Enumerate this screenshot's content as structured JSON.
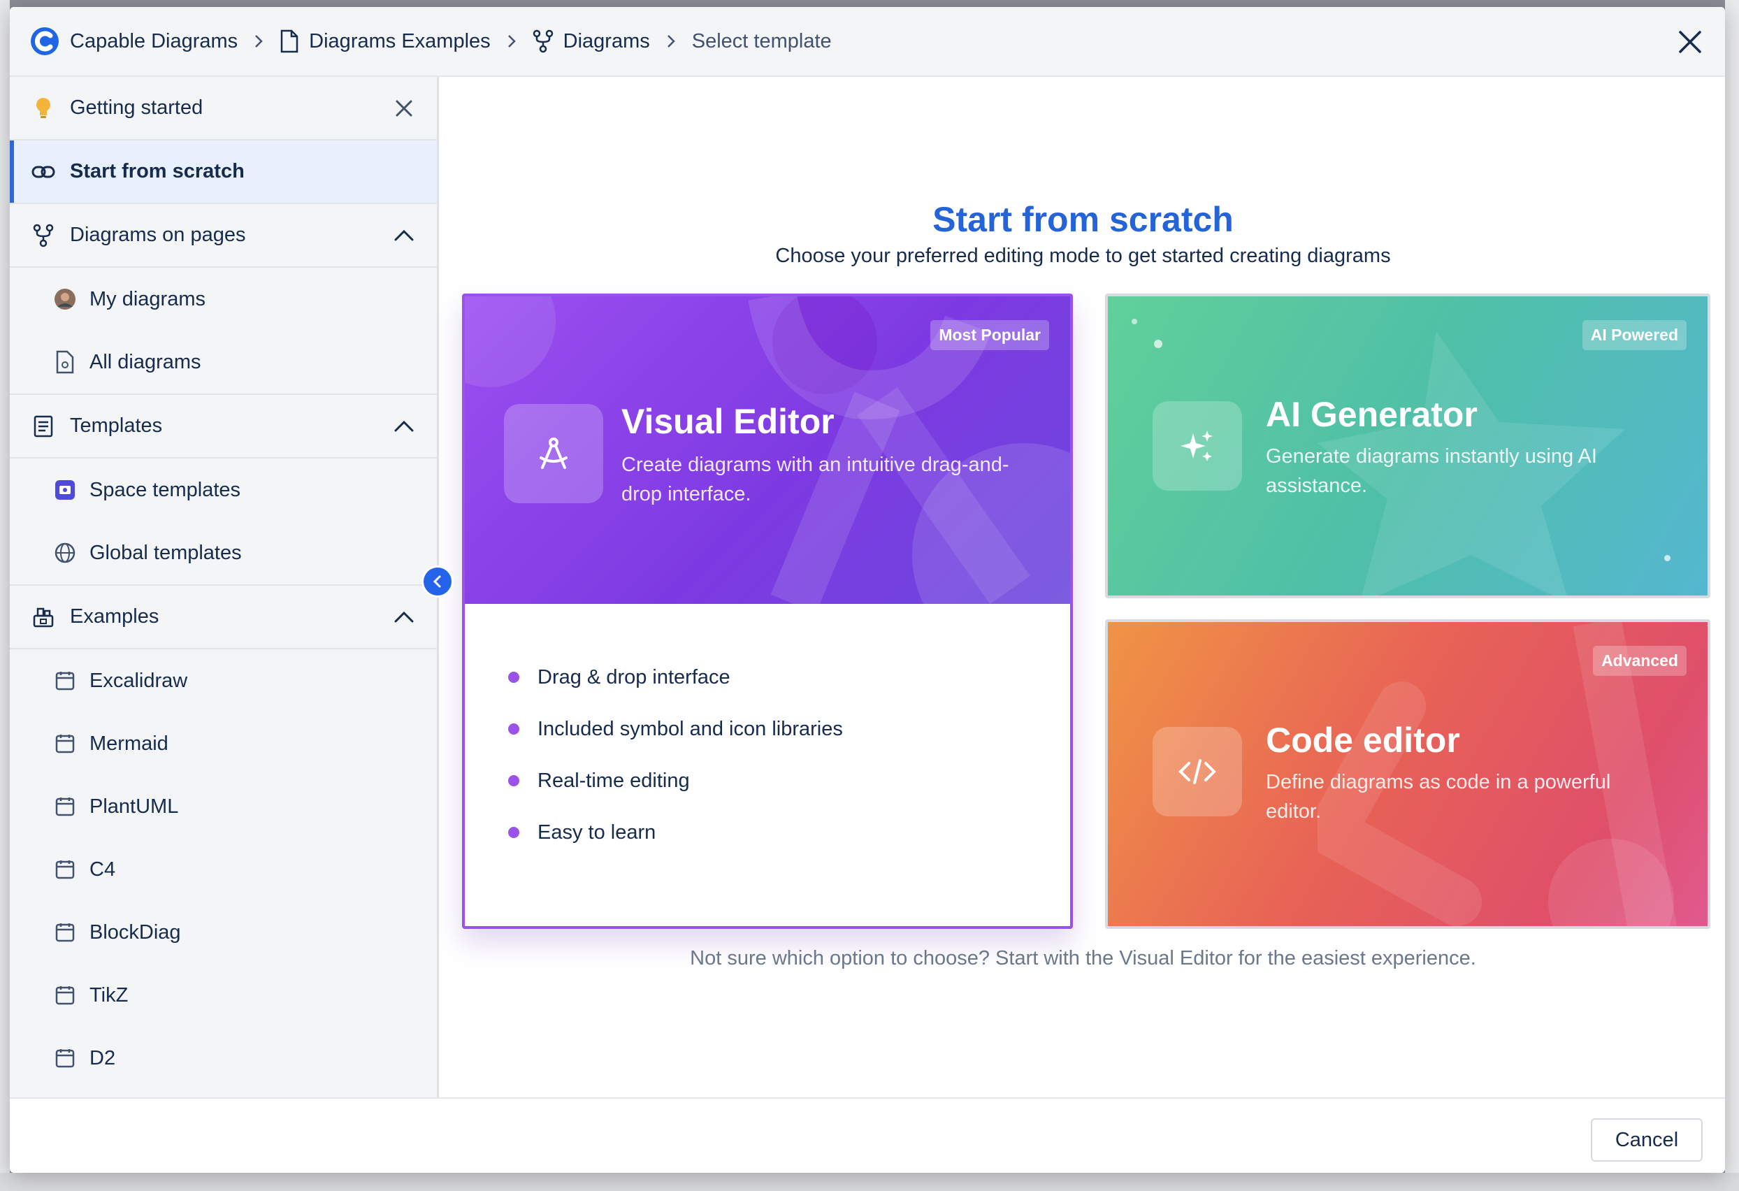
{
  "breadcrumb": {
    "app": "Capable Diagrams",
    "space": "Diagrams Examples",
    "section": "Diagrams",
    "current": "Select template"
  },
  "sidebar": {
    "getting_started": "Getting started",
    "start_from_scratch": "Start from scratch",
    "diagrams_on_pages": "Diagrams on pages",
    "my_diagrams": "My diagrams",
    "all_diagrams": "All diagrams",
    "templates": "Templates",
    "space_templates": "Space templates",
    "global_templates": "Global templates",
    "examples": "Examples",
    "example_items": [
      "Excalidraw",
      "Mermaid",
      "PlantUML",
      "C4",
      "BlockDiag",
      "TikZ",
      "D2"
    ]
  },
  "main": {
    "title": "Start from scratch",
    "subtitle": "Choose your preferred editing mode to get started creating diagrams",
    "hint": "Not sure which option to choose? Start with the Visual Editor for the easiest experience."
  },
  "cards": {
    "visual_editor": {
      "badge": "Most Popular",
      "title": "Visual Editor",
      "description": "Create diagrams with an intuitive drag-and-drop interface.",
      "features": [
        "Drag & drop interface",
        "Included symbol and icon libraries",
        "Real-time editing",
        "Easy to learn"
      ],
      "accent": "#9a52ea"
    },
    "ai_generator": {
      "badge": "AI Powered",
      "title": "AI Generator",
      "description": "Generate diagrams instantly using AI assistance."
    },
    "code_editor": {
      "badge": "Advanced",
      "title": "Code editor",
      "description": "Define diagrams as code in a powerful editor."
    }
  },
  "footer": {
    "cancel": "Cancel"
  },
  "colors": {
    "primary": "#2563d9",
    "active_bg": "#e8f0fd"
  }
}
